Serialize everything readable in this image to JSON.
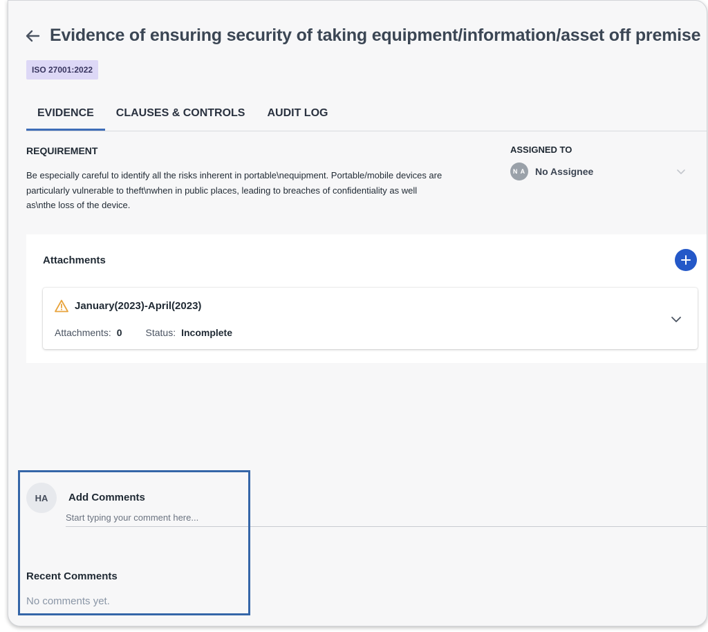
{
  "header": {
    "title": "Evidence of ensuring security of taking equipment/information/asset off premise"
  },
  "tag": "ISO 27001:2022",
  "tabs": [
    {
      "label": "EVIDENCE",
      "active": true
    },
    {
      "label": "CLAUSES & CONTROLS",
      "active": false
    },
    {
      "label": "AUDIT LOG",
      "active": false
    }
  ],
  "requirement": {
    "heading": "REQUIREMENT",
    "text": "Be especially careful to identify all the risks inherent in portable\\nequipment. Portable/mobile devices are particularly vulnerable to theft\\nwhen in public places, leading to breaches of confidentiality as well as\\nthe loss of the device."
  },
  "assigned": {
    "heading": "ASSIGNED TO",
    "avatar_initials": "N A",
    "name": "No Assignee"
  },
  "attachments": {
    "title": "Attachments",
    "add_icon": "plus-icon",
    "items": [
      {
        "title": "January(2023)-April(2023)",
        "status_icon": "warning-icon",
        "attachments_label": "Attachments:",
        "attachments_count": "0",
        "status_label": "Status:",
        "status_value": "Incomplete"
      }
    ]
  },
  "comments": {
    "avatar_initials": "HA",
    "add_title": "Add Comments",
    "placeholder": "Start typing your comment here...",
    "recent_title": "Recent Comments",
    "empty_text": "No comments yet."
  },
  "colors": {
    "accent": "#2458c8",
    "tab_underline": "#3e6db8",
    "tag_bg": "#ddd8f6",
    "warning": "#e8a33b",
    "highlight_box": "#3566a8"
  }
}
